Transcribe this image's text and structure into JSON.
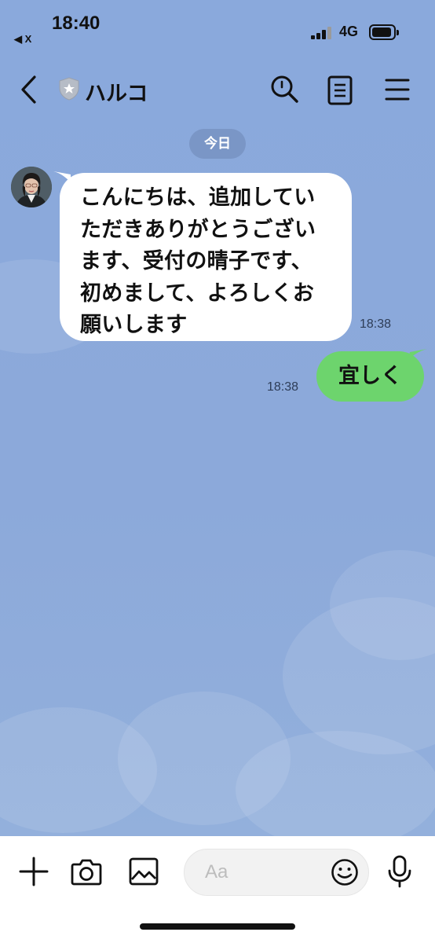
{
  "status_bar": {
    "time": "18:40",
    "back_to_app": "◀ X",
    "network": "4G",
    "signal_bars": 3,
    "battery_level": 0.8
  },
  "header": {
    "title": "ハルコ",
    "back_icon": "chevron-left-icon",
    "badge_icon": "shield-star-icon",
    "search_icon": "search-icon",
    "notes_icon": "note-icon",
    "menu_icon": "menu-icon"
  },
  "chat": {
    "date_label": "今日",
    "messages": [
      {
        "direction": "incoming",
        "lines": [
          "こんにちは、追加してい",
          "ただきありがとうござい",
          "ます、受付の晴子です、",
          "初めまして、よろしくお",
          "願いします"
        ],
        "time": "18:38"
      },
      {
        "direction": "outgoing",
        "text": "宜しく",
        "time": "18:38"
      }
    ]
  },
  "input_bar": {
    "placeholder": "Aa",
    "add_icon": "plus-icon",
    "camera_icon": "camera-icon",
    "image_icon": "image-icon",
    "emoji_icon": "emoji-icon",
    "mic_icon": "microphone-icon"
  },
  "colors": {
    "chat_background": "#8dabdb",
    "outgoing_bubble": "#6dd46d",
    "incoming_bubble": "#ffffff",
    "date_pill": "#7f97c4"
  }
}
